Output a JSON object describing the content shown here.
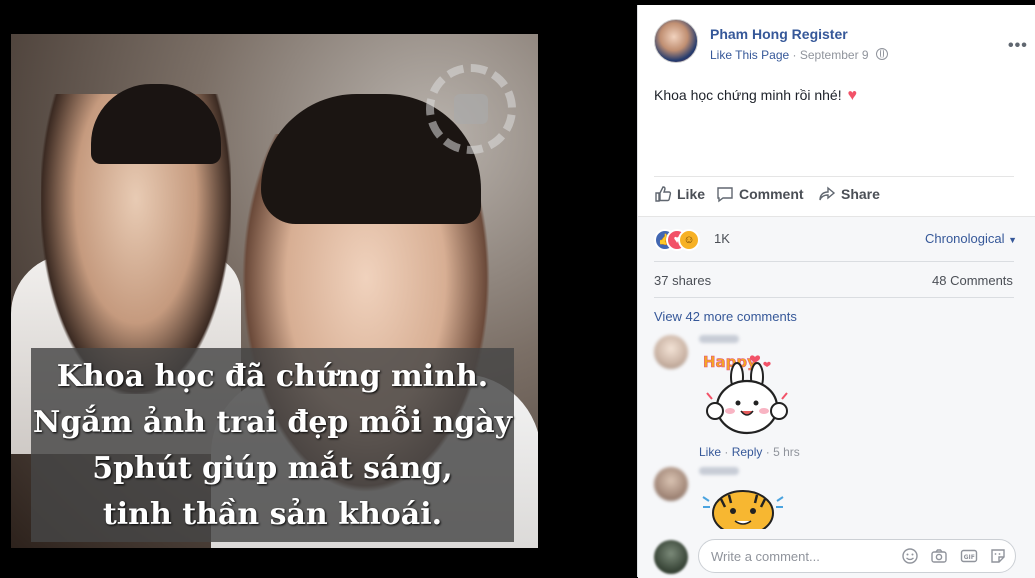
{
  "photo": {
    "caption_lines": [
      "Khoa học đã chứng minh.",
      "Ngắm ảnh trai đẹp mỗi ngày",
      "5phút giúp mắt sáng,",
      "tinh thần sản khoái."
    ]
  },
  "post": {
    "page_name": "Pham Hong Register",
    "like_page": "Like This Page",
    "separator": "·",
    "date": "September 9",
    "text": "Khoa học chứng minh rồi nhé!",
    "heart": "♥"
  },
  "actions": {
    "like": "Like",
    "comment": "Comment",
    "share": "Share"
  },
  "feedback": {
    "reaction_count": "1K",
    "sort_label": "Chronological",
    "shares": "37 shares",
    "comments": "48 Comments",
    "view_more": "View 42 more comments"
  },
  "comments": [
    {
      "sticker": "happy-bunny-sticker",
      "sticker_text": "Happy",
      "like": "Like",
      "dot": "·",
      "reply": "Reply",
      "time": "5 hrs"
    },
    {
      "sticker": "tiger-sticker"
    }
  ],
  "composer": {
    "placeholder": "Write a comment...",
    "icons": [
      "emoji-icon",
      "camera-icon",
      "gif-icon",
      "sticker-icon"
    ]
  },
  "colors": {
    "link": "#365899",
    "muted": "#90949c",
    "like_blue": "#4267b2",
    "love_red": "#f25268"
  }
}
